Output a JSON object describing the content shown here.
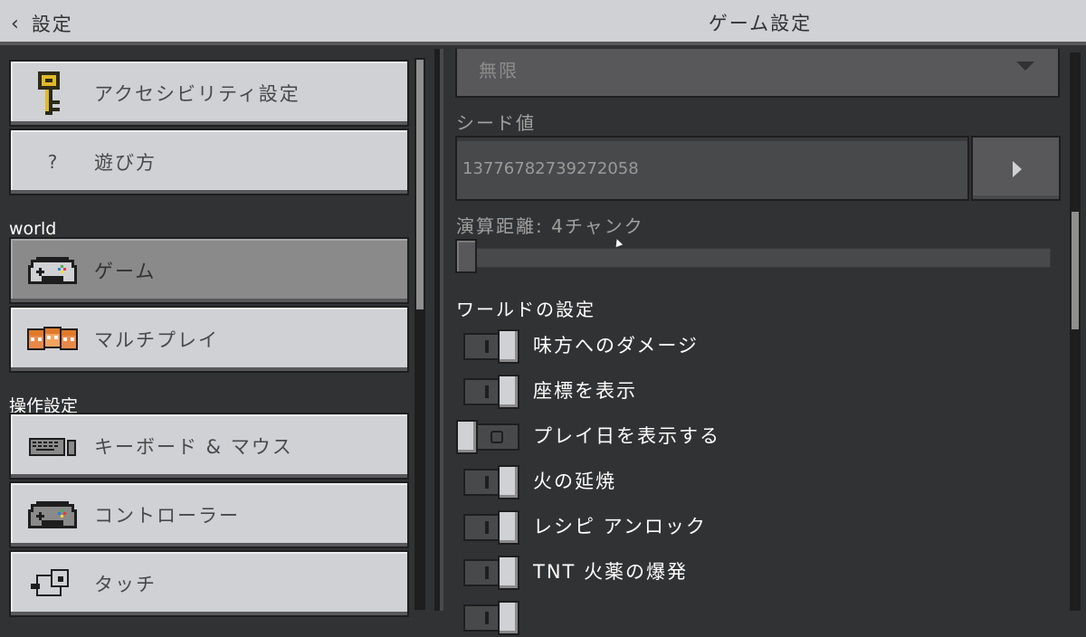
{
  "header": {
    "back_label": "設定",
    "title": "ゲーム設定"
  },
  "sidebar": {
    "items_top": [
      {
        "label": "アクセシビリティ設定",
        "icon": "key-icon"
      },
      {
        "label": "遊び方",
        "icon": "question-icon"
      }
    ],
    "world_section": "world",
    "world_items": [
      {
        "label": "ゲーム",
        "icon": "gamepad-icon",
        "selected": true
      },
      {
        "label": "マルチプレイ",
        "icon": "players-icon"
      }
    ],
    "controls_section": "操作設定",
    "controls_items": [
      {
        "label": "キーボード & マウス",
        "icon": "keyboard-icon"
      },
      {
        "label": "コントローラー",
        "icon": "controller-icon"
      },
      {
        "label": "タッチ",
        "icon": "touch-icon"
      }
    ]
  },
  "main": {
    "dropdown_value": "無限",
    "seed_label": "シード値",
    "seed_value": "13776782739272058",
    "sim_distance_label": "演算距離: 4チャンク",
    "world_settings_title": "ワールドの設定",
    "toggles": [
      {
        "label": "味方へのダメージ",
        "on": true
      },
      {
        "label": "座標を表示",
        "on": true
      },
      {
        "label": "プレイ日を表示する",
        "on": false
      },
      {
        "label": "火の延焼",
        "on": true
      },
      {
        "label": "レシピ アンロック",
        "on": true
      },
      {
        "label": "TNT 火薬の爆発",
        "on": true
      }
    ]
  },
  "colors": {
    "background": "#313233",
    "header": "#d0d1d4",
    "button": "#d0d1d4",
    "selected": "#8a8a8b"
  }
}
